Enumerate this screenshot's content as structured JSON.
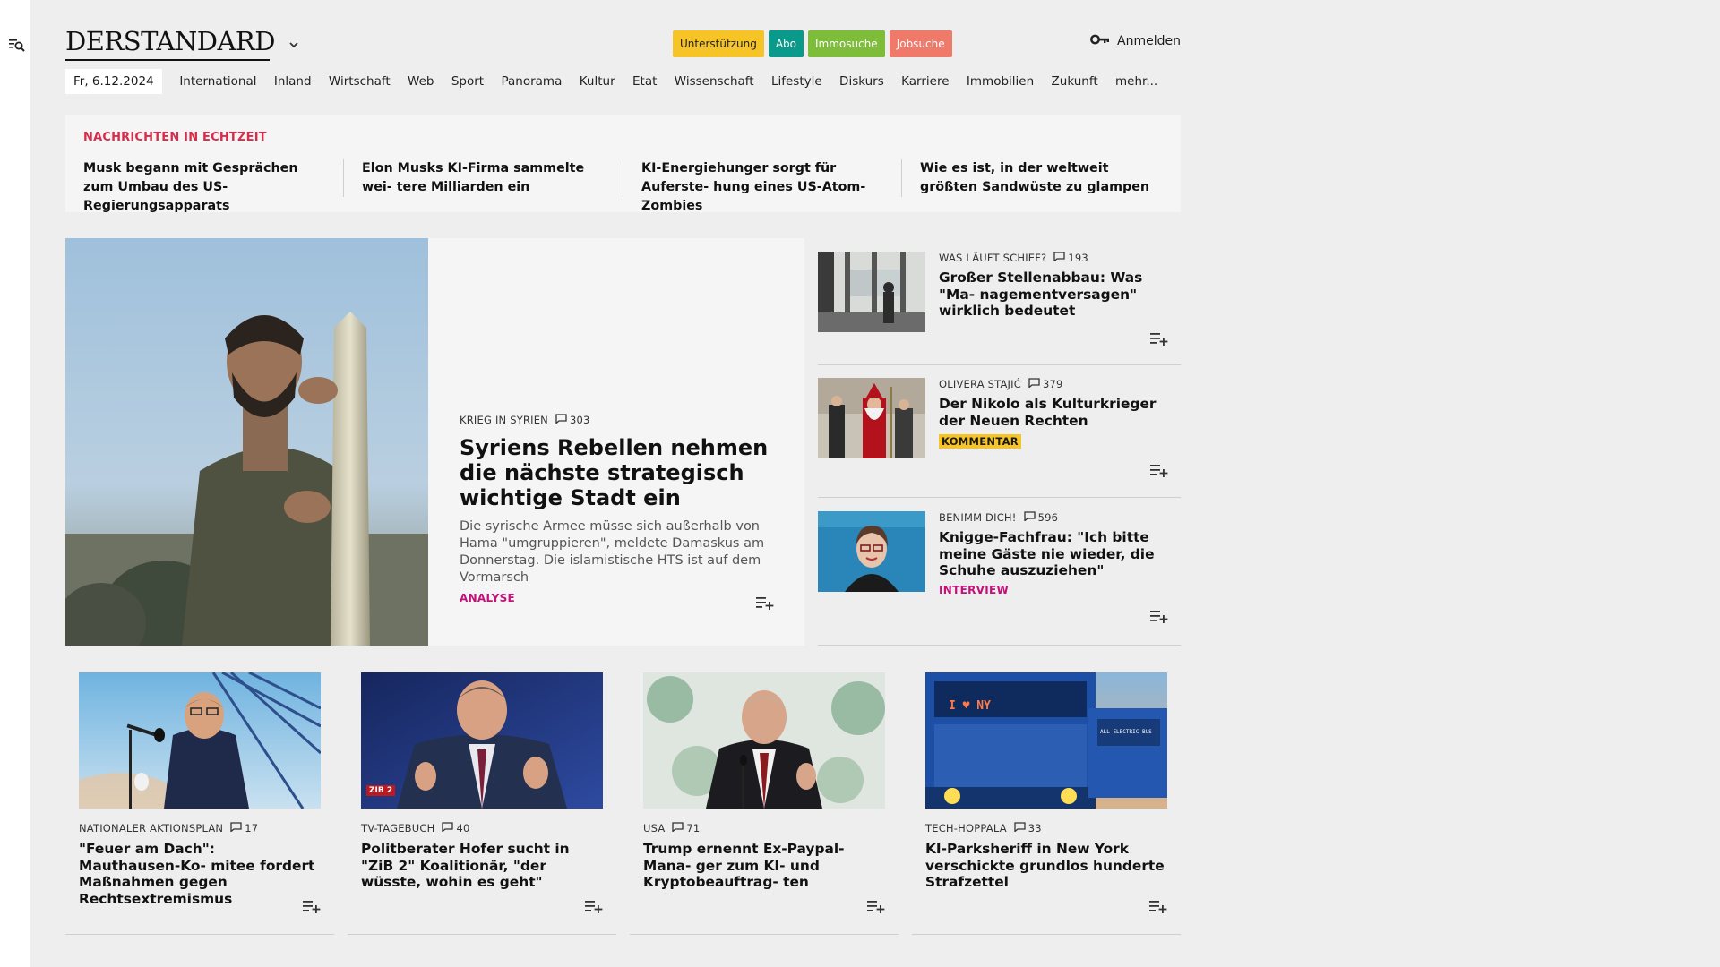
{
  "colors": {
    "realtime_label": "#d92b4a",
    "analyse": "#c2127a",
    "kommentar_bg": "#f6c426"
  },
  "header": {
    "logo": "DERSTANDARD",
    "pills": [
      {
        "label": "Unterstützung",
        "bg": "#f6c426",
        "fg": "#222222"
      },
      {
        "label": "Abo",
        "bg": "#0a9a8c",
        "fg": "#ffffff"
      },
      {
        "label": "Immosuche",
        "bg": "#7dbd3a",
        "fg": "#ffffff"
      },
      {
        "label": "Jobsuche",
        "bg": "#f07a6a",
        "fg": "#ffffff"
      }
    ],
    "login_label": "Anmelden",
    "icons": {
      "sidebar": "search-menu-icon",
      "login": "key-icon",
      "logo_menu": "chevron-down-icon"
    }
  },
  "nav": {
    "date": "Fr, 6.12.2024",
    "items": [
      "International",
      "Inland",
      "Wirtschaft",
      "Web",
      "Sport",
      "Panorama",
      "Kultur",
      "Etat",
      "Wissenschaft",
      "Lifestyle",
      "Diskurs",
      "Karriere",
      "Immobilien",
      "Zukunft",
      "mehr..."
    ]
  },
  "realtime": {
    "label": "NACHRICHTEN IN ECHTZEIT",
    "items": [
      "Musk begann mit Gesprächen zum Umbau des US-Regierungsapparats",
      "Elon Musks KI-Firma sammelte wei- tere Milliarden ein",
      "KI-Energiehunger sorgt für Auferste- hung eines US-Atom-Zombies",
      "Wie es ist, in der weltweit größten Sandwüste zu glampen"
    ]
  },
  "hero": {
    "kicker": "KRIEG IN SYRIEN",
    "comments": "303",
    "title": "Syriens Rebellen nehmen die nächste strategisch wichtige Stadt ein",
    "subtitle": "Die syrische Armee müsse sich außerhalb von Hama \"umgruppieren\", meldete Damaskus am Donnerstag. Die islamistische HTS ist auf dem Vormarsch",
    "tag": "ANALYSE"
  },
  "side": [
    {
      "kicker": "WAS LÄUFT SCHIEF?",
      "comments": "193",
      "title": "Großer Stellenabbau: Was \"Ma- nagementversagen\" wirklich bedeutet",
      "tag": ""
    },
    {
      "kicker": "OLIVERA STAJIĆ",
      "comments": "379",
      "title": "Der Nikolo als Kulturkrieger der Neuen Rechten",
      "tag": "KOMMENTAR"
    },
    {
      "kicker": "BENIMM DICH!",
      "comments": "596",
      "title": "Knigge-Fachfrau: \"Ich bitte meine Gäste nie wieder, die Schuhe auszuziehen\"",
      "tag": "INTERVIEW"
    }
  ],
  "cards": [
    {
      "kicker": "NATIONALER AKTIONSPLAN",
      "comments": "17",
      "title": "\"Feuer am Dach\": Mauthausen-Ko- mitee fordert Maßnahmen gegen Rechtsextremismus"
    },
    {
      "kicker": "TV-TAGEBUCH",
      "comments": "40",
      "title": "Politberater Hofer sucht in \"ZiB 2\" Koalitionär, \"der wüsste, wohin es geht\"",
      "badge": "ZIB 2"
    },
    {
      "kicker": "USA",
      "comments": "71",
      "title": "Trump ernennt Ex-Paypal-Mana- ger zum KI- und Kryptobeauftrag- ten"
    },
    {
      "kicker": "TECH-HOPPALA",
      "comments": "33",
      "title": "KI-Parksheriff in New York verschickte grundlos hunderte Strafzettel",
      "sign": "I ♥ NY",
      "sign2": "ALL-ELECTRIC BUS"
    }
  ]
}
